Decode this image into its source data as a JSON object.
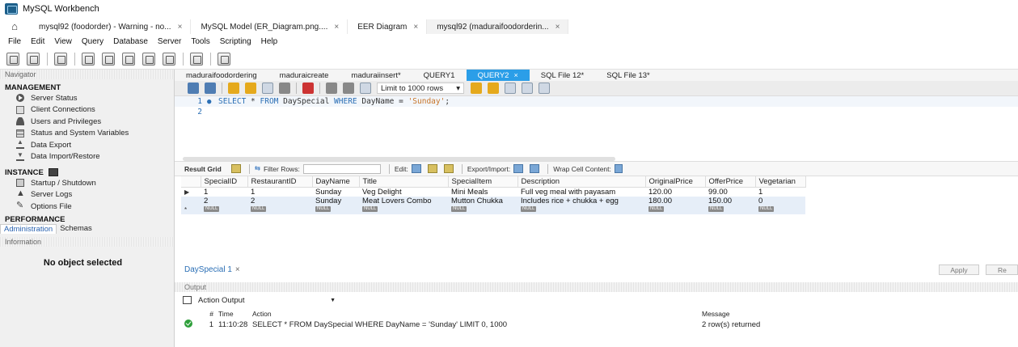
{
  "window": {
    "title": "MySQL Workbench"
  },
  "doc_tabs": [
    {
      "label": "mysql92 (foodorder) - Warning - no...",
      "close": "×",
      "active": false
    },
    {
      "label": "MySQL Model (ER_Diagram.png....",
      "close": "×",
      "active": false
    },
    {
      "label": "EER Diagram",
      "close": "×",
      "active": false
    },
    {
      "label": "mysql92 (maduraifoodorderin...",
      "close": "×",
      "active": true
    }
  ],
  "menu": [
    "File",
    "Edit",
    "View",
    "Query",
    "Database",
    "Server",
    "Tools",
    "Scripting",
    "Help"
  ],
  "sidebar": {
    "navigator_header": "Navigator",
    "management_title": "MANAGEMENT",
    "management_items": [
      "Server Status",
      "Client Connections",
      "Users and Privileges",
      "Status and System Variables",
      "Data Export",
      "Data Import/Restore"
    ],
    "instance_title": "INSTANCE",
    "instance_items": [
      "Startup / Shutdown",
      "Server Logs",
      "Options File"
    ],
    "performance_title": "PERFORMANCE",
    "tabs": [
      "Administration",
      "Schemas"
    ],
    "information_header": "Information",
    "no_object": "No object selected"
  },
  "query_tabs": [
    {
      "label": "maduraifoodordering",
      "active": false
    },
    {
      "label": "maduraicreate",
      "active": false
    },
    {
      "label": "maduraiinsert*",
      "active": false
    },
    {
      "label": "QUERY1",
      "active": false
    },
    {
      "label": "QUERY2",
      "active": true,
      "close": "×"
    },
    {
      "label": "SQL File 12*",
      "active": false
    },
    {
      "label": "SQL File 13*",
      "active": false
    }
  ],
  "sql_toolbar": {
    "limit": "Limit to 1000 rows"
  },
  "editor": {
    "lines": [
      {
        "num": "1",
        "marker": "●",
        "tokens": [
          {
            "t": "kw",
            "v": "SELECT"
          },
          {
            "t": "id",
            "v": " * "
          },
          {
            "t": "kw",
            "v": "FROM"
          },
          {
            "t": "id",
            "v": " DaySpecial "
          },
          {
            "t": "kw",
            "v": "WHERE"
          },
          {
            "t": "id",
            "v": " DayName = "
          },
          {
            "t": "str",
            "v": "'Sunday'"
          },
          {
            "t": "id",
            "v": ";"
          }
        ]
      },
      {
        "num": "2",
        "marker": "",
        "tokens": []
      }
    ]
  },
  "result_toolbar": {
    "result_grid": "Result Grid",
    "filter_rows": "Filter Rows:",
    "edit": "Edit:",
    "export_import": "Export/Import:",
    "wrap": "Wrap Cell Content:"
  },
  "grid": {
    "columns": [
      "SpecialID",
      "RestaurantID",
      "DayName",
      "Title",
      "SpecialItem",
      "Description",
      "OriginalPrice",
      "OfferPrice",
      "Vegetarian"
    ],
    "rows": [
      [
        "1",
        "1",
        "Sunday",
        "Veg Delight",
        "Mini Meals",
        "Full veg meal with payasam",
        "120.00",
        "99.00",
        "1"
      ],
      [
        "2",
        "2",
        "Sunday",
        "Meat Lovers Combo",
        "Mutton Chukka",
        "Includes rice + chukka + egg",
        "180.00",
        "150.00",
        "0"
      ]
    ],
    "null_label": "NULL",
    "current_marker": "▶",
    "new_marker": "*"
  },
  "result_tab": {
    "label": "DaySpecial 1",
    "close": "×"
  },
  "buttons": {
    "apply": "Apply",
    "revert": "Re"
  },
  "output": {
    "header": "Output",
    "selector": "Action Output",
    "columns": {
      "num": "#",
      "time": "Time",
      "action": "Action",
      "message": "Message"
    },
    "rows": [
      {
        "num": "1",
        "time": "11:10:28",
        "action": "SELECT * FROM DaySpecial WHERE DayName = 'Sunday' LIMIT 0, 1000",
        "message": "2 row(s) returned"
      }
    ]
  }
}
